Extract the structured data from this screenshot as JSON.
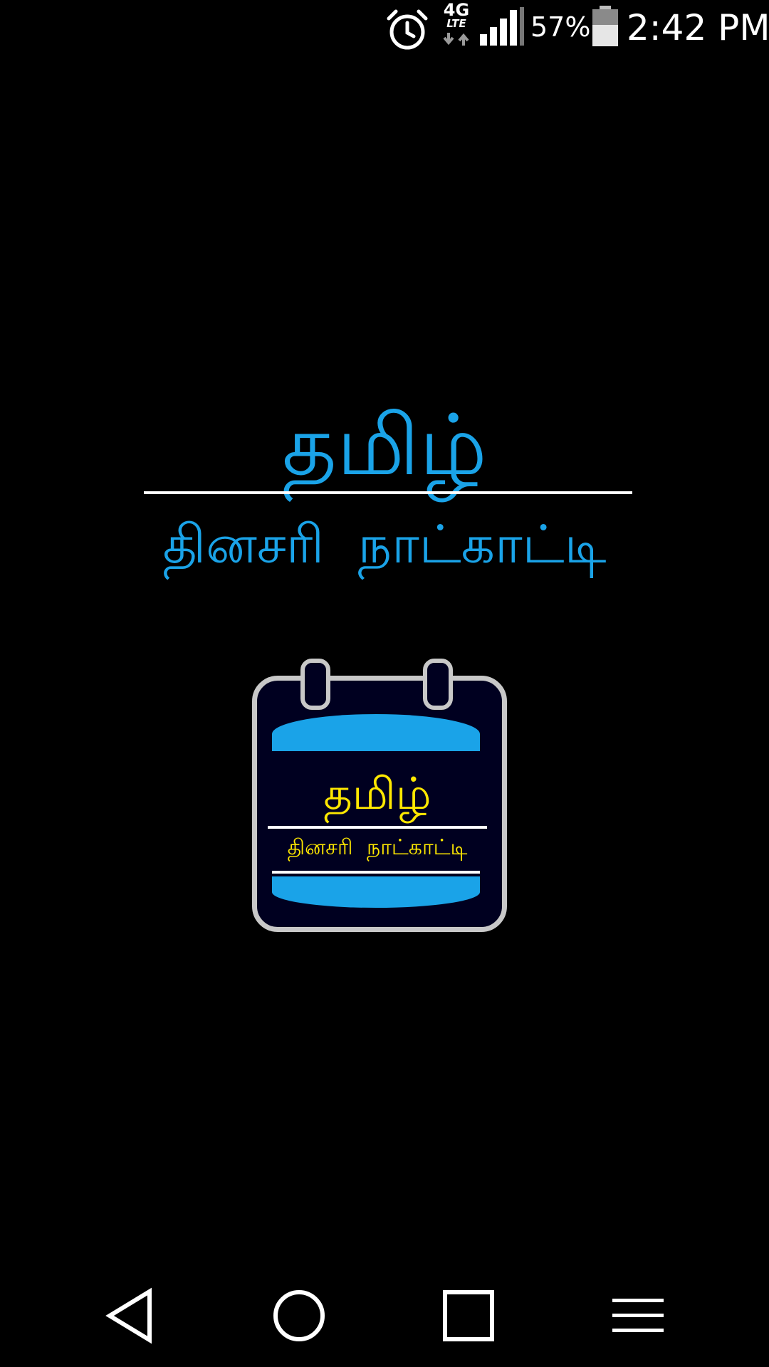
{
  "status_bar": {
    "network_type": "4G",
    "network_subtype": "LTE",
    "battery_percent": "57%",
    "time": "2:42 PM",
    "icons": {
      "alarm": "alarm-clock-icon",
      "network": "4g-lte-data-icon",
      "signal": "cell-signal-icon",
      "battery": "battery-icon"
    }
  },
  "splash": {
    "title": "தமிழ்",
    "subtitle": "தினசரி நாட்காட்டி",
    "title_color": "#1aa3e8"
  },
  "logo": {
    "title": "தமிழ்",
    "subtitle": "தினசரி நாட்காட்டி",
    "text_color": "#ffe800",
    "band_color": "#1aa3e8",
    "icon": "calendar-logo-icon"
  },
  "nav_bar": {
    "icons": [
      "back-icon",
      "home-icon",
      "recent-apps-icon",
      "menu-icon"
    ]
  }
}
